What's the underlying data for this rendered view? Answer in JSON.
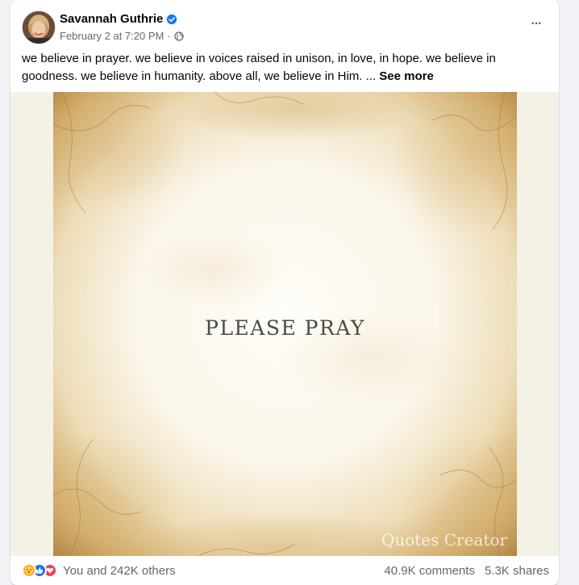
{
  "post": {
    "author": "Savannah Guthrie",
    "timestamp": "February 2 at 7:20 PM",
    "separator": "·",
    "caption": "we believe in prayer. we believe in voices raised in unison, in love, in hope. we believe in goodness. we believe in humanity. above all, we believe in Him. ... ",
    "see_more": "See more",
    "more_icon": "···"
  },
  "image": {
    "text": "PLEASE PRAY",
    "watermark": "Quotes Creator"
  },
  "footer": {
    "reaction_count": "You and 242K others",
    "comments": "40.9K comments",
    "shares": "5.3K shares"
  },
  "colors": {
    "verified": "#1877f2",
    "like": "#1b74e4",
    "love": "#f33e58",
    "care": "#f7b125",
    "parchment": "#c9a161"
  },
  "icons": [
    "verified-badge-icon",
    "globe-icon",
    "more-options-icon",
    "care-reaction-icon",
    "like-reaction-icon",
    "love-reaction-icon"
  ]
}
